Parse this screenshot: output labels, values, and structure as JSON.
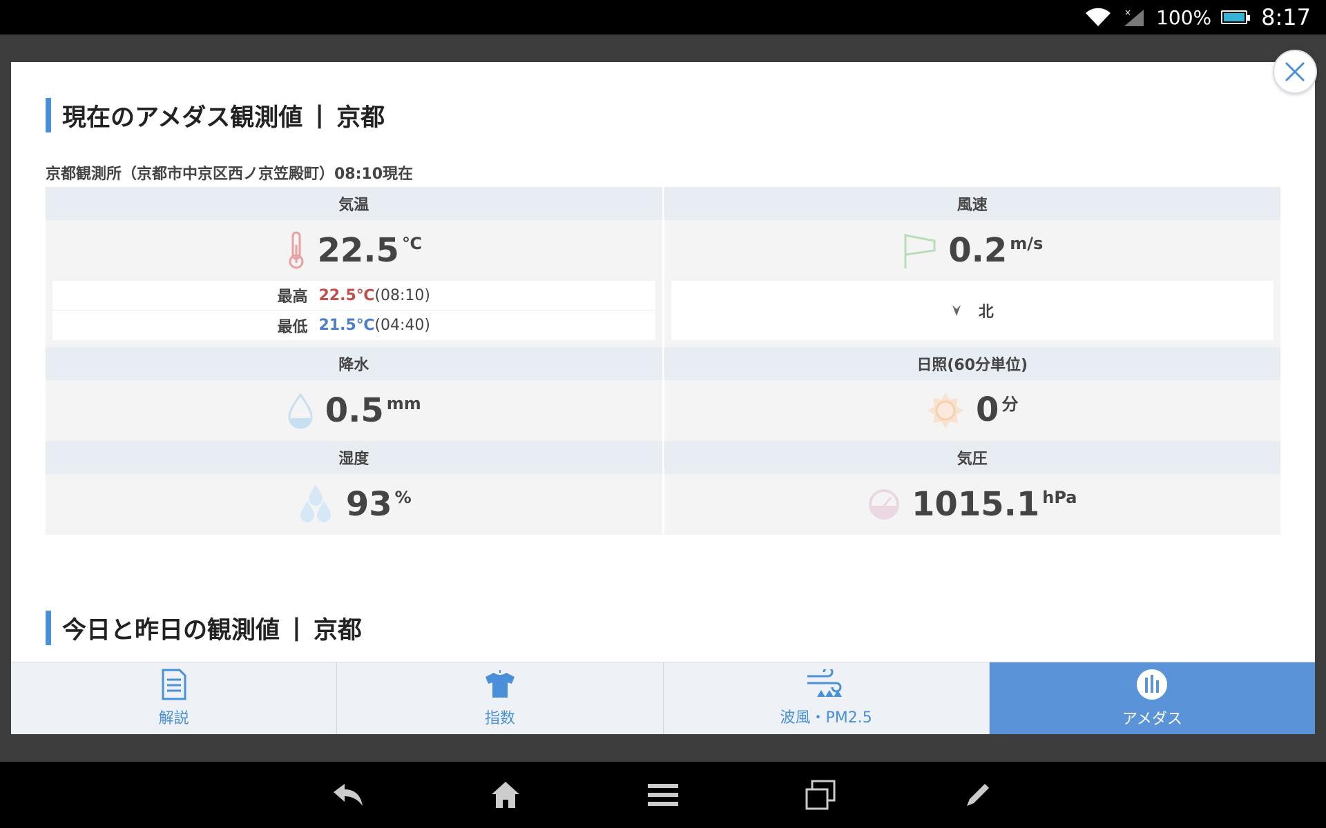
{
  "status_bar": {
    "battery_pct": "100%",
    "battery_level": 1.0,
    "time": "8:17"
  },
  "section1": {
    "title": "現在のアメダス観測値",
    "separator": "|",
    "location": "京都",
    "station": "京都観測所（京都市中京区西ノ京笠殿町）08:10現在"
  },
  "temperature": {
    "label": "気温",
    "value": "22.5",
    "unit": "℃",
    "max_label": "最高",
    "max_value": "22.5℃",
    "max_time": "(08:10)",
    "min_label": "最低",
    "min_value": "21.5℃",
    "min_time": "(04:40)"
  },
  "wind": {
    "label": "風速",
    "value": "0.2",
    "unit": "m/s",
    "direction": "北"
  },
  "precipitation": {
    "label": "降水",
    "value": "0.5",
    "unit": "mm"
  },
  "sunshine": {
    "label": "日照(60分単位)",
    "value": "0",
    "unit": "分"
  },
  "humidity": {
    "label": "湿度",
    "value": "93",
    "unit": "%"
  },
  "pressure": {
    "label": "気圧",
    "value": "1015.1",
    "unit": "hPa"
  },
  "section2": {
    "title": "今日と昨日の観測値",
    "separator": "|",
    "location": "京都"
  },
  "tabs": [
    {
      "label": "解説",
      "icon": "document-icon"
    },
    {
      "label": "指数",
      "icon": "shirt-icon"
    },
    {
      "label": "波風・PM2.5",
      "icon": "wave-wind-icon"
    },
    {
      "label": "アメダス",
      "icon": "bar-chart-icon",
      "active": true
    }
  ],
  "colors": {
    "accent": "#4a90d9",
    "active_tab": "#5b93d8",
    "max_temp": "#c0504d",
    "min_temp": "#4a7fc9"
  }
}
